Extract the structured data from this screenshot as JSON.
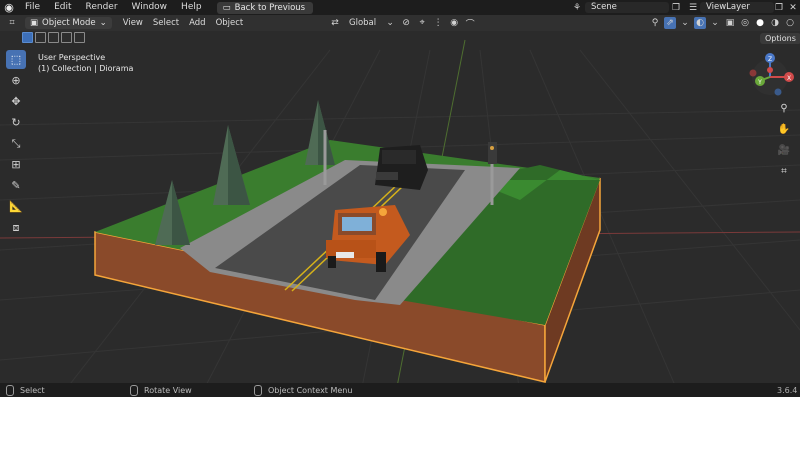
{
  "topbar": {
    "menus": [
      "File",
      "Edit",
      "Render",
      "Window",
      "Help"
    ],
    "back_button": "Back to Previous",
    "scene": "Scene",
    "view_layer": "ViewLayer"
  },
  "header": {
    "mode": "Object Mode",
    "menus": [
      "View",
      "Select",
      "Add",
      "Object"
    ],
    "orientation": "Global",
    "options": "Options"
  },
  "viewport": {
    "line1": "User Perspective",
    "line2": "(1) Collection | Diorama"
  },
  "status": {
    "left": "Select",
    "middle": "Rotate View",
    "right": "Object Context Menu",
    "version": "3.6.4"
  },
  "gizmo": {
    "x": "X",
    "y": "Y",
    "z": "Z"
  },
  "colors": {
    "accent": "#4772b3",
    "selection_outline": "#f5a53a"
  }
}
